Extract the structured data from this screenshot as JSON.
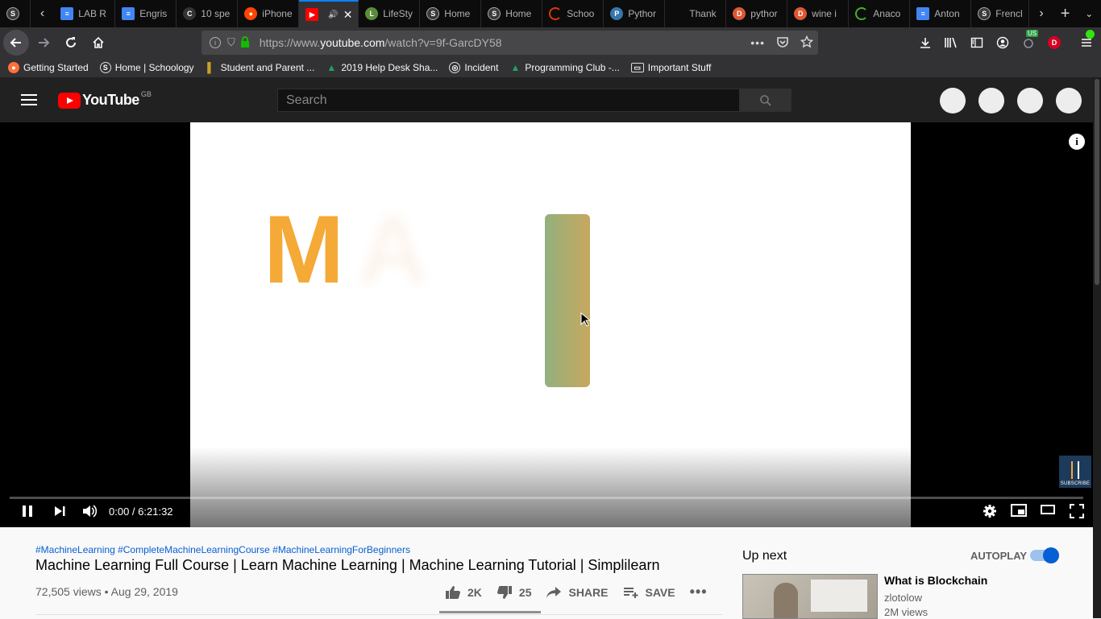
{
  "browser": {
    "tabs": [
      {
        "label": "",
        "icon": "schoology-icon",
        "color": "#3a3a3d"
      },
      {
        "label": "LAB R",
        "icon": "docs-icon",
        "color": "#4285f4"
      },
      {
        "label": "Engris",
        "icon": "docs-icon",
        "color": "#4285f4"
      },
      {
        "label": "10 spe",
        "icon": "cpu-icon",
        "color": "#333333"
      },
      {
        "label": "iPhone",
        "icon": "reddit-icon",
        "color": "#ff4500"
      },
      {
        "label": "",
        "icon": "youtube-icon",
        "color": "#ff0000"
      },
      {
        "label": "LifeSty",
        "icon": "lifestyle-icon",
        "color": "#5b8c3a"
      },
      {
        "label": "Home",
        "icon": "schoology-icon",
        "color": "#3a3a3d"
      },
      {
        "label": "Home",
        "icon": "schoology-icon",
        "color": "#3a3a3d"
      },
      {
        "label": "Schoo",
        "icon": "loading-icon",
        "color": "#d83b01"
      },
      {
        "label": "Pythor",
        "icon": "python-icon",
        "color": "#3776ab"
      },
      {
        "label": "Thank",
        "icon": "blank-icon",
        "color": "#0c0c0d"
      },
      {
        "label": "pythor",
        "icon": "duckduckgo-icon",
        "color": "#de5833"
      },
      {
        "label": "wine i",
        "icon": "duckduckgo-icon",
        "color": "#de5833"
      },
      {
        "label": "Anaco",
        "icon": "anaconda-icon",
        "color": "#43b02a"
      },
      {
        "label": "Anton",
        "icon": "docs-icon",
        "color": "#4285f4"
      },
      {
        "label": "French",
        "icon": "schoology-icon",
        "color": "#3a3a3d"
      }
    ],
    "url_prefix": "https://www.",
    "url_host": "youtube.com",
    "url_path": "/watch?v=9f-GarcDY58",
    "bookmarks": [
      {
        "label": "Getting Started",
        "icon": "firefox-icon",
        "color": "#ff7139"
      },
      {
        "label": "Home | Schoology",
        "icon": "schoology-icon",
        "color": "#323234"
      },
      {
        "label": "Student and Parent ...",
        "icon": "page-icon",
        "color": "#c9a227"
      },
      {
        "label": "2019 Help Desk Sha...",
        "icon": "drive-icon",
        "color": "#1fa463"
      },
      {
        "label": "Incident",
        "icon": "globe-icon",
        "color": "#323234"
      },
      {
        "label": "Programming Club -...",
        "icon": "drive-icon",
        "color": "#1fa463"
      },
      {
        "label": "Important Stuff",
        "icon": "folder-icon",
        "color": "#323234"
      }
    ],
    "badge_us": "US",
    "profile_letter": "D"
  },
  "youtube": {
    "logo_text": "YouTube",
    "region": "GB",
    "search_placeholder": "Search"
  },
  "player": {
    "slide_letter_1": "M",
    "slide_letter_2": "A",
    "info_glyph": "i",
    "watermark_label": "SUBSCRIBE",
    "time_current": "0:00",
    "time_separator": " / ",
    "time_total": "6:21:32",
    "progress": 0.0
  },
  "video": {
    "hashtags": "#MachineLearning #CompleteMachineLearningCourse #MachineLearningForBeginners",
    "title": "Machine Learning Full Course | Learn Machine Learning | Machine Learning Tutorial | Simplilearn",
    "views": "72,505 views",
    "date_sep": " • ",
    "date": "Aug 29, 2019",
    "likes": "2K",
    "dislikes": "25",
    "share_label": "SHARE",
    "save_label": "SAVE"
  },
  "sidebar": {
    "up_next": "Up next",
    "autoplay_label": "AUTOPLAY",
    "autoplay_on": true,
    "next_title": "What is Blockchain",
    "next_channel": "zlotolow",
    "next_views": "2M views"
  }
}
